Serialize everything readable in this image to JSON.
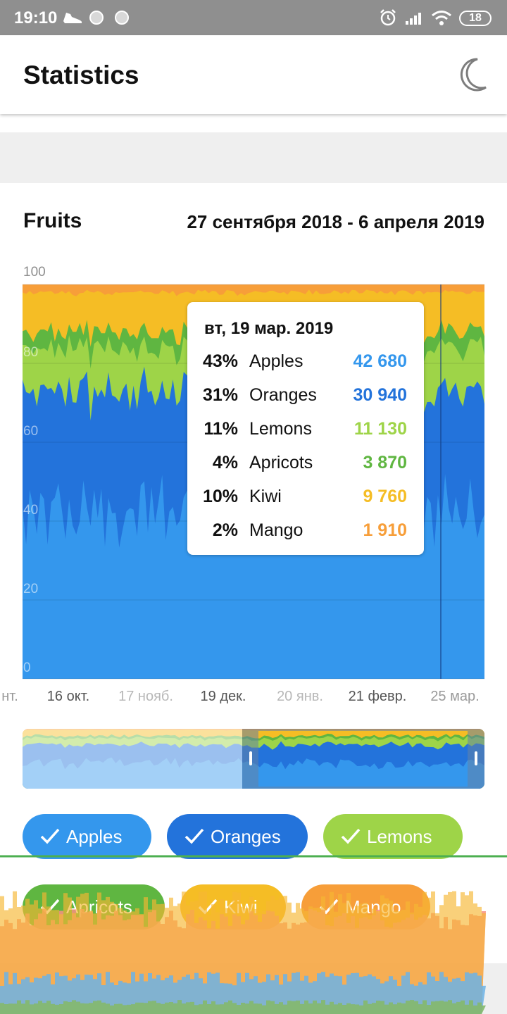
{
  "status_bar": {
    "time": "19:10",
    "battery": "18"
  },
  "app_bar": {
    "title": "Statistics"
  },
  "card": {
    "title": "Fruits",
    "date_range": "27 сентября 2018 - 6 апреля 2019"
  },
  "chart_data": {
    "type": "area",
    "stacked": "percentage",
    "ylim": [
      0,
      100
    ],
    "y_ticks": [
      "100",
      "80",
      "60",
      "40",
      "20",
      "0"
    ],
    "x_tick_labels": [
      "нт.",
      "16 окт.",
      "17 нояб.",
      "19 дек.",
      "20 янв.",
      "21 февр.",
      "25 мар."
    ],
    "grid": true,
    "series": [
      {
        "name": "Apples",
        "color": "#3497ED",
        "approx_share": 43
      },
      {
        "name": "Oranges",
        "color": "#2373DB",
        "approx_share": 31
      },
      {
        "name": "Lemons",
        "color": "#9ED448",
        "approx_share": 11
      },
      {
        "name": "Apricots",
        "color": "#5FB641",
        "approx_share": 4
      },
      {
        "name": "Kiwi",
        "color": "#F5BD25",
        "approx_share": 10
      },
      {
        "name": "Mango",
        "color": "#F79E39",
        "approx_share": 2
      }
    ]
  },
  "tooltip": {
    "date": "вт, 19 мар. 2019",
    "rows": [
      {
        "pct": "43%",
        "name": "Apples",
        "value": "42 680",
        "color": "#3497ED"
      },
      {
        "pct": "31%",
        "name": "Oranges",
        "value": "30 940",
        "color": "#2373DB"
      },
      {
        "pct": "11%",
        "name": "Lemons",
        "value": "11 130",
        "color": "#9ED448"
      },
      {
        "pct": "4%",
        "name": "Apricots",
        "value": "3 870",
        "color": "#5FB641"
      },
      {
        "pct": "10%",
        "name": "Kiwi",
        "value": "9 760",
        "color": "#F5BD25"
      },
      {
        "pct": "2%",
        "name": "Mango",
        "value": "1 910",
        "color": "#F79E39"
      }
    ]
  },
  "chips": [
    {
      "label": "Apples",
      "color": "#3497ED",
      "checked": true
    },
    {
      "label": "Oranges",
      "color": "#2373DB",
      "checked": true
    },
    {
      "label": "Lemons",
      "color": "#9ED448",
      "checked": true
    },
    {
      "label": "Apricots",
      "color": "#5FB641",
      "checked": true
    },
    {
      "label": "Kiwi",
      "color": "#F5BD25",
      "checked": true
    },
    {
      "label": "Mango",
      "color": "#F79E39",
      "checked": true
    }
  ]
}
